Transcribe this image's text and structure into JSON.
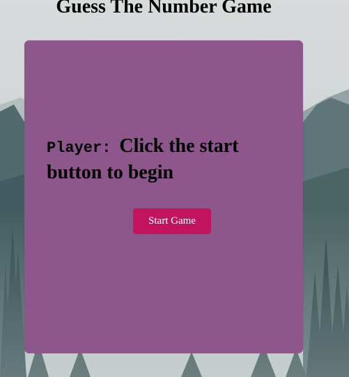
{
  "page": {
    "title": "Guess The Number Game"
  },
  "card": {
    "player_label": "Player:",
    "status_message": "Click the start button to begin",
    "start_button_label": "Start Game"
  },
  "colors": {
    "card_background": "#8e578c",
    "button_background": "#c2145e",
    "button_text": "#ffffff",
    "title_text": "#000000"
  }
}
